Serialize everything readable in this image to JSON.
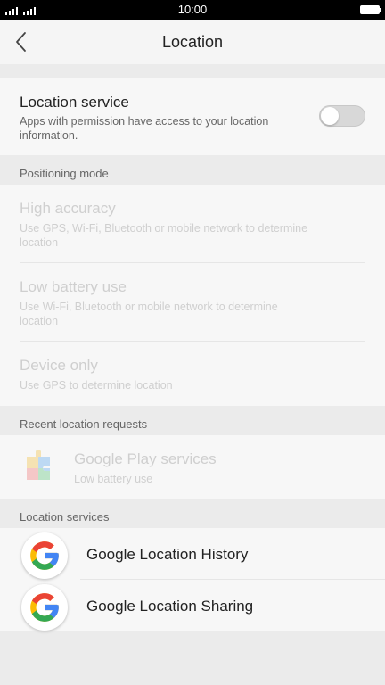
{
  "status_bar": {
    "time": "10:00"
  },
  "header": {
    "title": "Location"
  },
  "location_service": {
    "title": "Location service",
    "description": "Apps with permission have access to your location information.",
    "toggle_on": false
  },
  "positioning_mode": {
    "label": "Positioning mode",
    "options": [
      {
        "title": "High accuracy",
        "description": "Use GPS, Wi-Fi, Bluetooth or mobile network to determine location"
      },
      {
        "title": "Low battery use",
        "description": "Use Wi-Fi, Bluetooth or mobile network to determine location"
      },
      {
        "title": "Device only",
        "description": "Use GPS to determine location"
      }
    ]
  },
  "recent_requests": {
    "label": "Recent location requests",
    "items": [
      {
        "name": "Google Play services",
        "detail": "Low battery use",
        "icon": "google-play-services-icon"
      }
    ]
  },
  "location_services": {
    "label": "Location services",
    "items": [
      {
        "name": "Google Location History",
        "icon": "google-g-icon"
      },
      {
        "name": "Google Location Sharing",
        "icon": "google-g-icon"
      }
    ]
  },
  "colors": {
    "background": "#ebebeb",
    "card": "#f7f7f7",
    "disabled_text": "#cfcfcf",
    "google_blue": "#4285F4",
    "google_red": "#EA4335",
    "google_yellow": "#FBBC05",
    "google_green": "#34A853"
  }
}
